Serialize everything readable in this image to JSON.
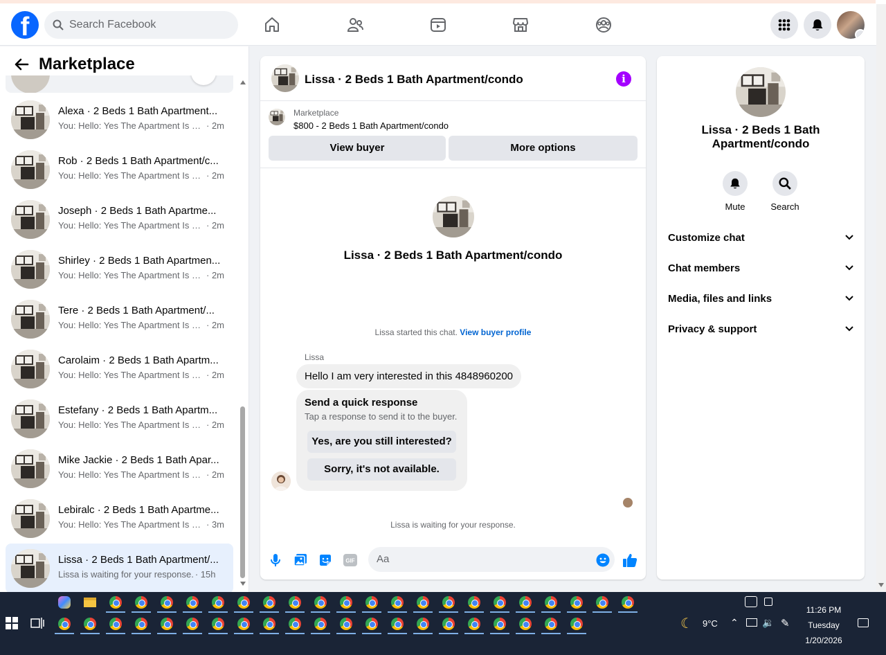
{
  "header": {
    "search_placeholder": "Search Facebook"
  },
  "sidebar": {
    "title": "Marketplace",
    "conversations": [
      {
        "name": "Alexa · 2 Beds 1 Bath Apartment...",
        "preview": "You: Hello: Yes The Apartment Is St...",
        "time": "· 2m"
      },
      {
        "name": "Rob · 2 Beds 1 Bath Apartment/c...",
        "preview": "You: Hello: Yes The Apartment Is St...",
        "time": "· 2m"
      },
      {
        "name": "Joseph · 2 Beds 1 Bath Apartme...",
        "preview": "You: Hello: Yes The Apartment Is St...",
        "time": "· 2m"
      },
      {
        "name": "Shirley · 2 Beds 1 Bath Apartmen...",
        "preview": "You: Hello: Yes The Apartment Is St...",
        "time": "· 2m"
      },
      {
        "name": "Tere · 2 Beds 1 Bath Apartment/...",
        "preview": "You: Hello: Yes The Apartment Is St...",
        "time": "· 2m"
      },
      {
        "name": "Carolaim · 2 Beds 1 Bath Apartm...",
        "preview": "You: Hello: Yes The Apartment Is St...",
        "time": "· 2m"
      },
      {
        "name": "Estefany · 2 Beds 1 Bath Apartm...",
        "preview": "You: Hello: Yes The Apartment Is St...",
        "time": "· 2m"
      },
      {
        "name": "Mike Jackie · 2 Beds 1 Bath Apar...",
        "preview": "You: Hello: Yes The Apartment Is St...",
        "time": "· 2m"
      },
      {
        "name": "Lebiralc · 2 Beds 1 Bath Apartme...",
        "preview": "You: Hello: Yes The Apartment Is St...",
        "time": "· 3m"
      },
      {
        "name": "Lissa · 2 Beds 1 Bath Apartment/...",
        "preview": "Lissa is waiting for your response.",
        "time": "· 15h"
      }
    ]
  },
  "chat": {
    "title": "Lissa · 2 Beds 1 Bath Apartment/condo",
    "listing_source": "Marketplace",
    "listing_item": "$800 - 2 Beds 1 Bath Apartment/condo",
    "view_buyer_label": "View buyer",
    "more_options_label": "More options",
    "profile_name": "Lissa · 2 Beds 1 Bath Apartment/condo",
    "started_text": "Lissa started this chat.",
    "view_buyer_profile_link": "View buyer profile",
    "sender_name": "Lissa",
    "message": "Hello I am very interested in this 4848960200",
    "quick_title": "Send a quick response",
    "quick_subtitle": "Tap a response to send it to the buyer.",
    "quick_options": [
      "Yes, are you still interested?",
      "Sorry, it's not available."
    ],
    "waiting_text": "Lissa is waiting for your response.",
    "composer_placeholder": "Aa",
    "gif_label": "GIF"
  },
  "details": {
    "name": "Lissa · 2 Beds 1 Bath Apartment/condo",
    "mute_label": "Mute",
    "search_label": "Search",
    "sections": [
      "Customize chat",
      "Chat members",
      "Media, files and links",
      "Privacy & support"
    ]
  },
  "taskbar": {
    "weather": "9°C",
    "time": "11:26 PM",
    "day": "Tuesday",
    "date": "1/20/2026"
  },
  "colors": {
    "facebook_blue": "#0866ff",
    "messenger_blue": "#0084ff",
    "info_purple": "#a400ff",
    "active_conversation": "#e7f0fd"
  },
  "icons": [
    "facebook-logo",
    "search-icon",
    "home-icon",
    "friends-icon",
    "video-icon",
    "marketplace-icon",
    "groups-icon",
    "menu-grid-icon",
    "bell-icon",
    "back-arrow-icon",
    "info-icon",
    "mic-icon",
    "photo-icon",
    "sticker-icon",
    "gif-icon",
    "emoji-icon",
    "like-icon",
    "chevron-down-icon",
    "windows-start-icon",
    "task-view-icon",
    "chrome-icon",
    "moon-icon",
    "notification-icon"
  ]
}
